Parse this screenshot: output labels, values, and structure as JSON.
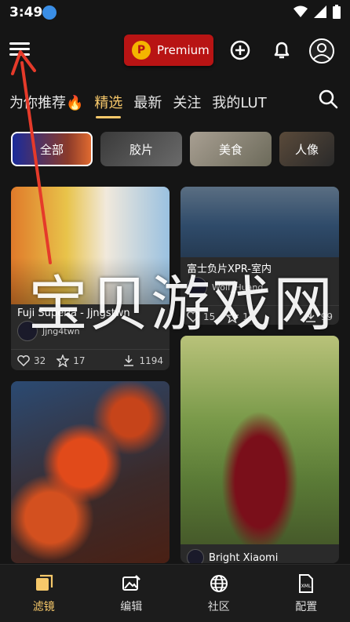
{
  "status_bar": {
    "time": "3:49"
  },
  "topbar": {
    "premium_label": "Premium",
    "premium_badge": "P"
  },
  "tabs": [
    {
      "label": "为你推荐🔥"
    },
    {
      "label": "精选"
    },
    {
      "label": "最新"
    },
    {
      "label": "关注"
    },
    {
      "label": "我的LUT"
    }
  ],
  "categories": [
    {
      "label": "全部"
    },
    {
      "label": "胶片"
    },
    {
      "label": "美食"
    },
    {
      "label": "人像"
    }
  ],
  "cards": [
    {
      "title": "Fuji Superia - Jjngstwn",
      "author": "Jjng4twn",
      "likes": "32",
      "stars": "17",
      "downloads": "1194"
    },
    {
      "title": "富士负片XPR-室内",
      "author": "Wolf_Huang",
      "likes": "15",
      "stars": "1",
      "downloads": "99"
    },
    {
      "title": "",
      "author": ""
    },
    {
      "title": "Bright Xiaomi",
      "author": ""
    }
  ],
  "watermark": "宝贝游戏网",
  "bottom_nav": [
    {
      "label": "滤镜"
    },
    {
      "label": "编辑"
    },
    {
      "label": "社区"
    },
    {
      "label": "配置"
    }
  ],
  "colors": {
    "accent": "#f6c86a",
    "premium": "#b81414",
    "background": "#151515"
  }
}
